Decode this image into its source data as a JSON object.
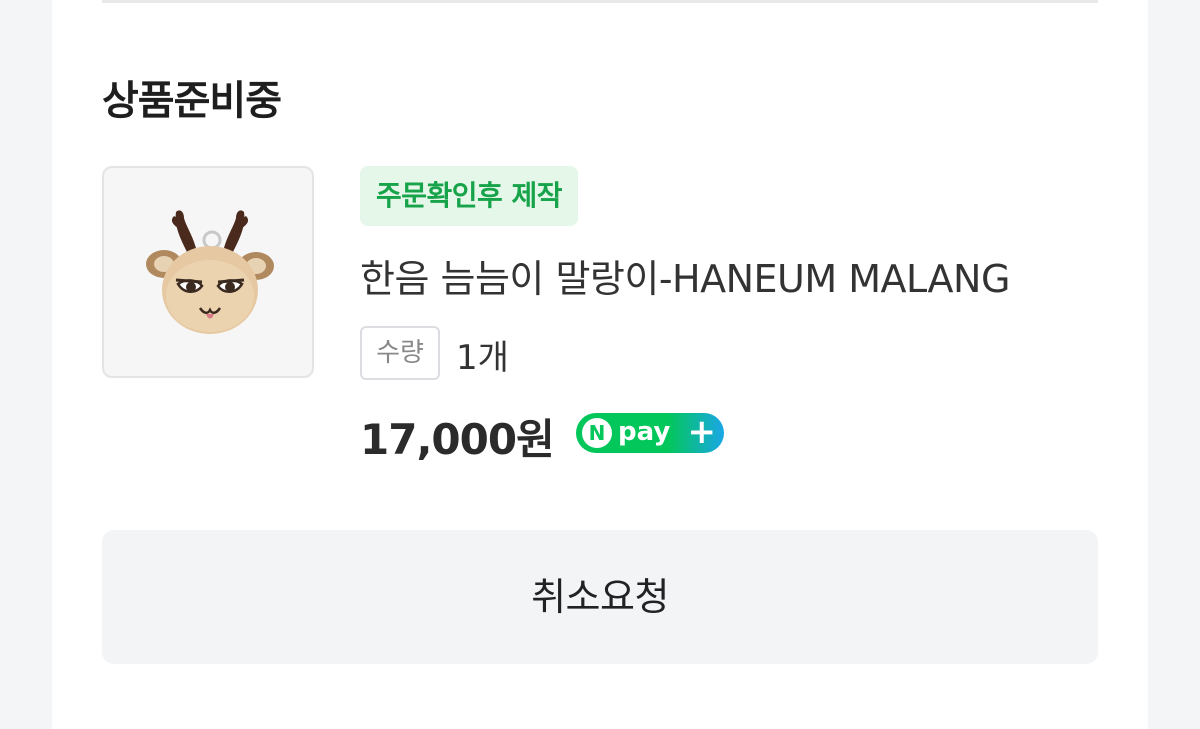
{
  "order": {
    "status_title": "상품준비중",
    "badge_label": "주문확인후 제작",
    "product_name": "한음 늠늠이 말랑이-HANEUM MALANG",
    "quantity_label": "수량",
    "quantity_value": "1개",
    "price": "17,000원",
    "payment": {
      "n_letter": "N",
      "label": "pay",
      "plus": "+"
    },
    "cancel_label": "취소요청"
  },
  "colors": {
    "badge_text": "#17a34a",
    "badge_bg": "#e4f7e9",
    "npay_green": "#03c75a",
    "npay_blue": "#1aa6e6",
    "button_bg": "#f2f4f6"
  },
  "icons": {
    "product_image": "deer-plush-keychain-image",
    "npay_logo": "naver-pay-plus-icon"
  }
}
